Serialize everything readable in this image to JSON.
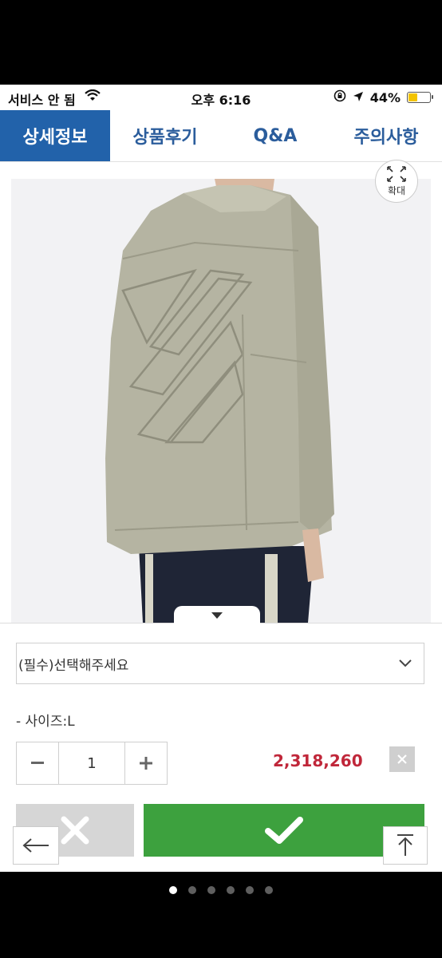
{
  "status_bar": {
    "carrier": "서비스 안 됨",
    "time": "오후 6:16",
    "battery": "44%",
    "battery_level": 0.44
  },
  "tabs": [
    {
      "label": "상세정보",
      "active": true
    },
    {
      "label": "상품후기",
      "active": false
    },
    {
      "label": "Q&A",
      "active": false
    },
    {
      "label": "주의사항",
      "active": false
    }
  ],
  "zoom": {
    "label": "확대"
  },
  "options": {
    "select_placeholder": "(필수)선택해주세요",
    "selected_line": "- 사이즈:L",
    "quantity": "1",
    "price": "2,318,260"
  },
  "icons": {
    "close": "close-icon",
    "wifi": "wifi-icon",
    "location": "location-icon",
    "lock_rotation": "rotation-lock-icon",
    "expand": "expand-icon",
    "chevron": "chevron-down-icon",
    "minus": "minus-icon",
    "plus": "plus-icon",
    "check": "check-icon",
    "arrow_left": "arrow-left-icon",
    "scroll_top": "scroll-top-icon"
  },
  "colors": {
    "tab_active": "#2262aa",
    "tab_text": "#2b5d9c",
    "price": "#c0273a",
    "confirm": "#3da13e"
  },
  "pagination": {
    "count": 6,
    "active_index": 0
  }
}
